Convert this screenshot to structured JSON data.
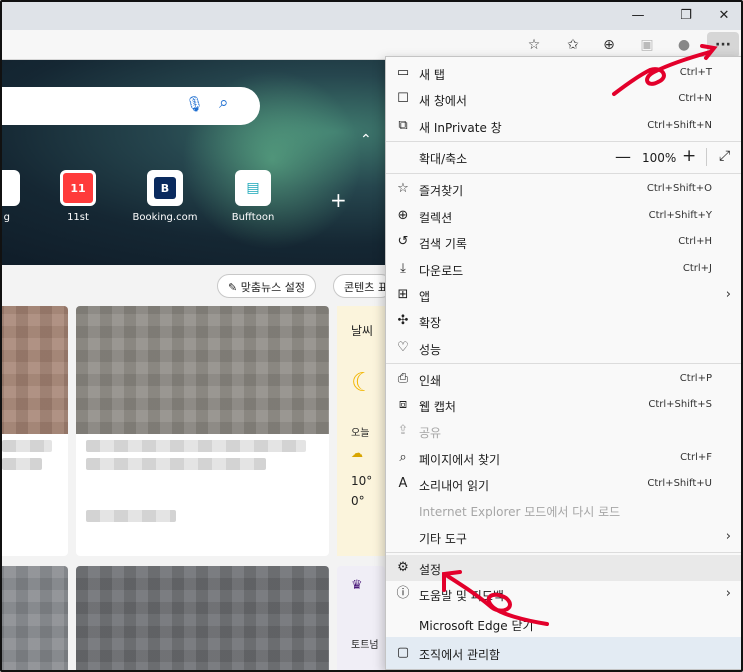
{
  "window": {
    "minimize": "—",
    "maximize": "❐",
    "close": "✕"
  },
  "toolbar": {
    "more_label": "···"
  },
  "ntp": {
    "tiles": [
      {
        "label": "g",
        "mark": ""
      },
      {
        "label": "11st",
        "mark": "11"
      },
      {
        "label": "Booking.com",
        "mark": "B"
      },
      {
        "label": "Bufftoon",
        "mark": "▤"
      }
    ],
    "news_settings": "맞춤뉴스 설정",
    "content_btn": "콘텐츠 표",
    "weather_title": "날씨",
    "weather_today": "오늘",
    "weather_high": "10°",
    "weather_low": "0°",
    "sports_label": "토트넘"
  },
  "menu": {
    "new_tab": {
      "label": "새 탭",
      "shortcut": "Ctrl+T"
    },
    "new_window": {
      "label": "새 창에서",
      "shortcut": "Ctrl+N"
    },
    "new_inprivate": {
      "label": "새 InPrivate 창",
      "shortcut": "Ctrl+Shift+N"
    },
    "zoom": {
      "label": "확대/축소",
      "value": "100%"
    },
    "favorites": {
      "label": "즐겨찾기",
      "shortcut": "Ctrl+Shift+O"
    },
    "collections": {
      "label": "컬렉션",
      "shortcut": "Ctrl+Shift+Y"
    },
    "history": {
      "label": "검색 기록",
      "shortcut": "Ctrl+H"
    },
    "downloads": {
      "label": "다운로드",
      "shortcut": "Ctrl+J"
    },
    "apps": {
      "label": "앱"
    },
    "extensions": {
      "label": "확장"
    },
    "performance": {
      "label": "성능"
    },
    "print": {
      "label": "인쇄",
      "shortcut": "Ctrl+P"
    },
    "web_capture": {
      "label": "웹 캡처",
      "shortcut": "Ctrl+Shift+S"
    },
    "share": {
      "label": "공유"
    },
    "find": {
      "label": "페이지에서 찾기",
      "shortcut": "Ctrl+F"
    },
    "read_aloud": {
      "label": "소리내어 읽기",
      "shortcut": "Ctrl+Shift+U"
    },
    "ie_mode": {
      "label": "Internet Explorer 모드에서 다시 로드"
    },
    "more_tools": {
      "label": "기타 도구"
    },
    "settings": {
      "label": "설정"
    },
    "help": {
      "label": "도움말 및 피드백"
    },
    "close_edge": {
      "label": "Microsoft Edge 닫기"
    },
    "managed": {
      "label": "조직에서 관리함"
    }
  },
  "colors": {
    "annotation": "#e3002b",
    "accent": "#1f6fd1"
  }
}
